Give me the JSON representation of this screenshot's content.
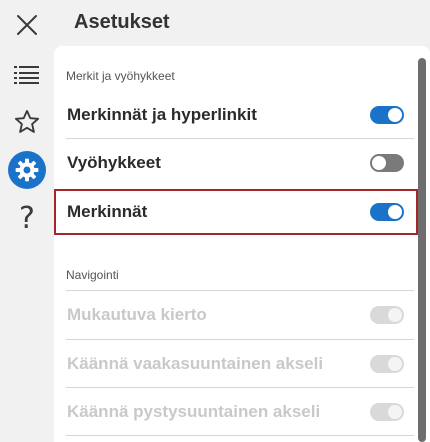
{
  "header": {
    "title": "Asetukset"
  },
  "rail": {
    "items": [
      {
        "icon": "close-icon"
      },
      {
        "icon": "list-icon"
      },
      {
        "icon": "star-icon"
      },
      {
        "icon": "gear-icon",
        "active": true
      },
      {
        "icon": "help-icon",
        "glyph": "?"
      }
    ]
  },
  "sections": [
    {
      "label": "Merkit ja vyöhykkeet",
      "rows": [
        {
          "label": "Merkinnät ja hyperlinkit",
          "state": "on",
          "disabled": false
        },
        {
          "label": "Vyöhykkeet",
          "state": "off",
          "disabled": false
        },
        {
          "label": "Merkinnät",
          "state": "on",
          "disabled": false,
          "highlighted": true
        }
      ]
    },
    {
      "label": "Navigointi",
      "rows": [
        {
          "label": "Mukautuva kierto",
          "state": "on",
          "disabled": true
        },
        {
          "label": "Käännä vaakasuuntainen akseli",
          "state": "on",
          "disabled": true
        },
        {
          "label": "Käännä pystysuuntainen akseli",
          "state": "on",
          "disabled": true
        }
      ]
    }
  ],
  "colors": {
    "accent": "#1a73c8",
    "highlight_border": "#a3262a",
    "toggle_off": "#7a7a7a",
    "disabled_text": "#c9c9c9"
  }
}
